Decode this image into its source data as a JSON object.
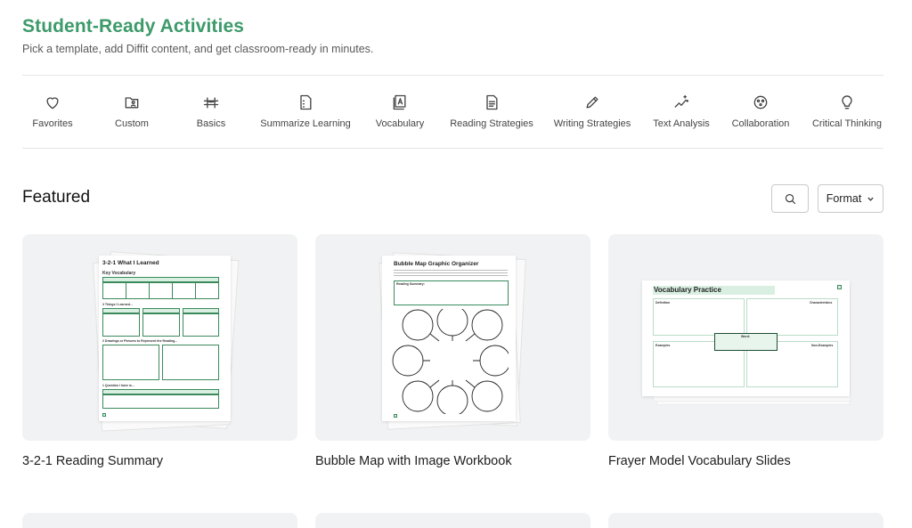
{
  "header": {
    "title": "Student-Ready Activities",
    "subtitle": "Pick a template, add Diffit content, and get classroom-ready in minutes."
  },
  "categories": [
    {
      "label": "Favorites",
      "icon": "heart-icon"
    },
    {
      "label": "Custom",
      "icon": "folder-user-icon"
    },
    {
      "label": "Basics",
      "icon": "bridge-icon"
    },
    {
      "label": "Summarize Learning",
      "icon": "document-summary-icon"
    },
    {
      "label": "Vocabulary",
      "icon": "vocabulary-book-icon"
    },
    {
      "label": "Reading Strategies",
      "icon": "document-lines-icon"
    },
    {
      "label": "Writing Strategies",
      "icon": "pencil-icon"
    },
    {
      "label": "Text Analysis",
      "icon": "chart-sparkle-icon"
    },
    {
      "label": "Collaboration",
      "icon": "group-circle-icon"
    },
    {
      "label": "Critical Thinking",
      "icon": "lightbulb-icon"
    }
  ],
  "featured": {
    "title": "Featured",
    "format_label": "Format",
    "cards": [
      {
        "title": "3-2-1 Reading Summary",
        "thumb": {
          "heading": "3-2-1 What I Learned",
          "section1": "Key Vocabulary",
          "section2": "3 Things I Learned...",
          "section3": "2 Drawings or Pictures to Represent the Reading...",
          "section4": "1 Question I have is..."
        }
      },
      {
        "title": "Bubble Map with Image Workbook",
        "thumb": {
          "heading": "Bubble Map Graphic Organizer",
          "box_label": "Reading Summary:"
        }
      },
      {
        "title": "Frayer Model Vocabulary Slides",
        "thumb": {
          "heading": "Vocabulary Practice",
          "q1": "Definition",
          "q2": "Characteristics",
          "q3": "Examples",
          "q4": "Non-Examples",
          "center": "Word:"
        }
      }
    ]
  },
  "colors": {
    "brand": "#3d9a6a",
    "card_bg": "#f1f2f3"
  }
}
